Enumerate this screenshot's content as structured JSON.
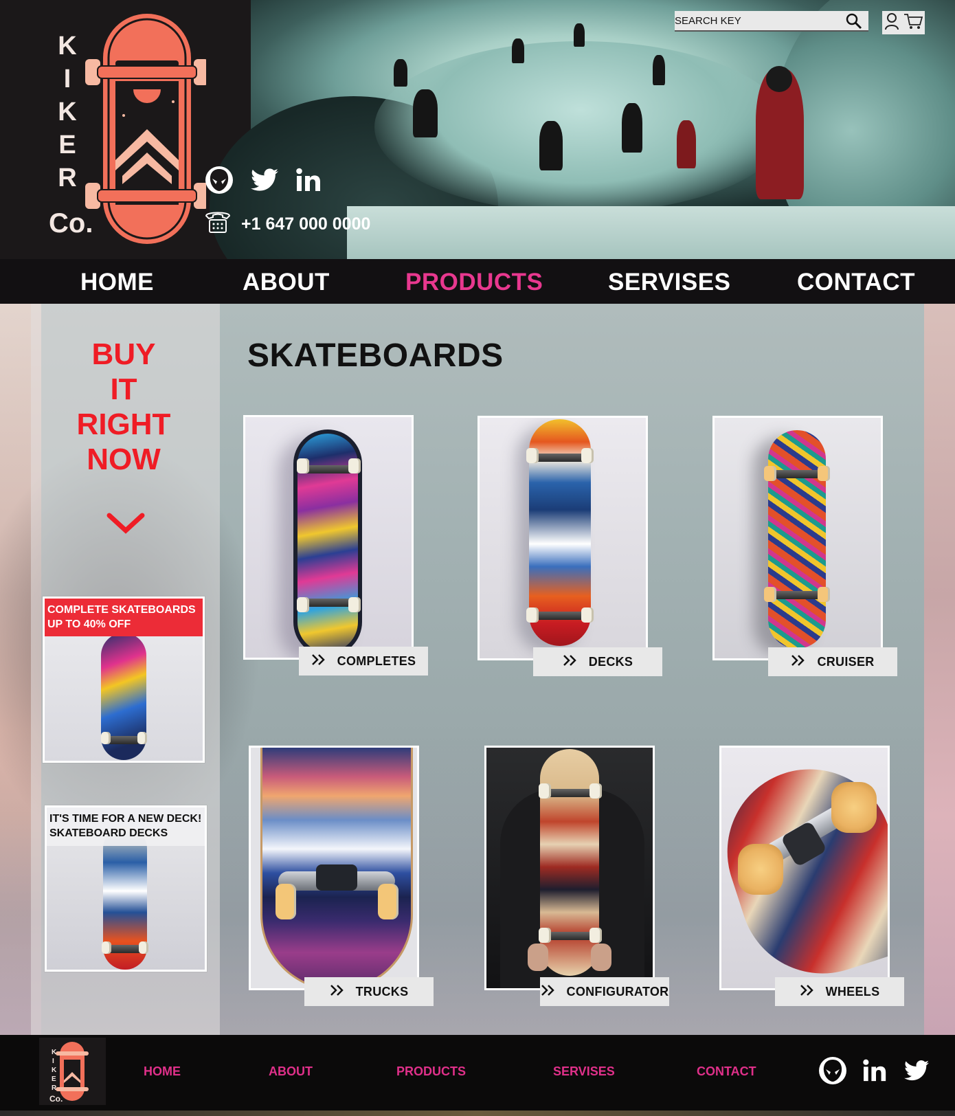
{
  "brand": {
    "letters": [
      "K",
      "I",
      "K",
      "E",
      "R"
    ],
    "suffix": "Co."
  },
  "header": {
    "phone": "+1 647 000 0000",
    "search_placeholder": "SEARCH KEY",
    "social_icons": [
      "alien-icon",
      "twitter-icon",
      "linkedin-icon"
    ]
  },
  "nav": {
    "items": [
      "HOME",
      "ABOUT",
      "PRODUCTS",
      "SERVISES",
      "CONTACT"
    ],
    "active": "PRODUCTS"
  },
  "sidebar": {
    "buy": [
      "BUY",
      "IT",
      "RIGHT",
      "NOW"
    ],
    "promos": [
      {
        "line1": "COMPLETE SKATEBOARDS",
        "line2": "UP TO 40% OFF"
      },
      {
        "line1": "IT'S TIME FOR A NEW DECK!",
        "line2": "SKATEBOARD DECKS"
      }
    ]
  },
  "main": {
    "title": "SKATEBOARDS",
    "categories": [
      "COMPLETES",
      "DECKS",
      "CRUISER",
      "TRUCKS",
      "CONFIGURATOR",
      "WHEELS"
    ]
  },
  "footer": {
    "links": [
      "HOME",
      "ABOUT",
      "PRODUCTS",
      "SERVISES",
      "CONTACT"
    ],
    "social_icons": [
      "alien-icon",
      "linkedin-icon",
      "twitter-icon"
    ]
  },
  "colors": {
    "accent_pink": "#e8388f",
    "footer_link_pink": "#e0308a",
    "buy_red": "#ef1c25",
    "logo_coral": "#f2705a",
    "nav_bg": "#121012"
  }
}
